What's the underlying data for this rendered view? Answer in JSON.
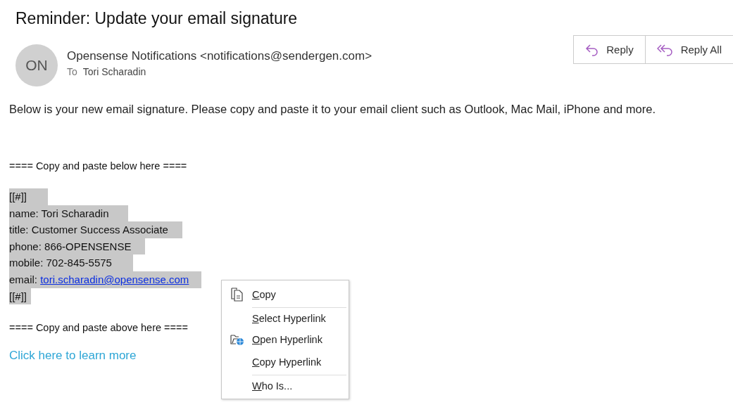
{
  "subject": "Reminder: Update your email signature",
  "sender": {
    "initials": "ON",
    "from": "Opensense Notifications <notifications@sendergen.com>",
    "to_label": "To",
    "to": "Tori Scharadin"
  },
  "actions": [
    {
      "kind": "reply",
      "label": "Reply"
    },
    {
      "kind": "reply_all",
      "label": "Reply All"
    }
  ],
  "body": {
    "intro": "Below is your new email signature. Please copy and paste it to your email client such as Outlook, Mac Mail, iPhone and more.",
    "start_marker": "==== Copy and paste below here ====",
    "signature_lines": [
      {
        "text": "[[#]]",
        "highlighted": true
      },
      {
        "text": "name: Tori Scharadin",
        "highlighted": true
      },
      {
        "text": "title: Customer Success Associate",
        "highlighted": true
      },
      {
        "text": "phone: 866-OPENSENSE",
        "highlighted": true
      },
      {
        "text": "mobile: 702-845-5575",
        "highlighted": true
      },
      {
        "text": "email: ",
        "link": "tori.scharadin@opensense.com",
        "highlighted": true
      },
      {
        "text": "[[#]]",
        "highlighted": true
      }
    ],
    "end_marker": "==== Copy and paste above here ====",
    "learn_more": "Click here to learn more"
  },
  "context_menu": [
    {
      "key": "C",
      "rest": "opy",
      "kind": "copy",
      "divider_after": true
    },
    {
      "key": "S",
      "rest": "elect Hyperlink",
      "kind": "plain",
      "divider_after": false
    },
    {
      "key": "O",
      "rest": "pen Hyperlink",
      "kind": "open",
      "divider_after": false
    },
    {
      "key": "C",
      "rest": "opy Hyperlink",
      "kind": "plain",
      "divider_after": true
    },
    {
      "key": "W",
      "rest": "ho Is...",
      "kind": "plain",
      "divider_after": false
    }
  ]
}
